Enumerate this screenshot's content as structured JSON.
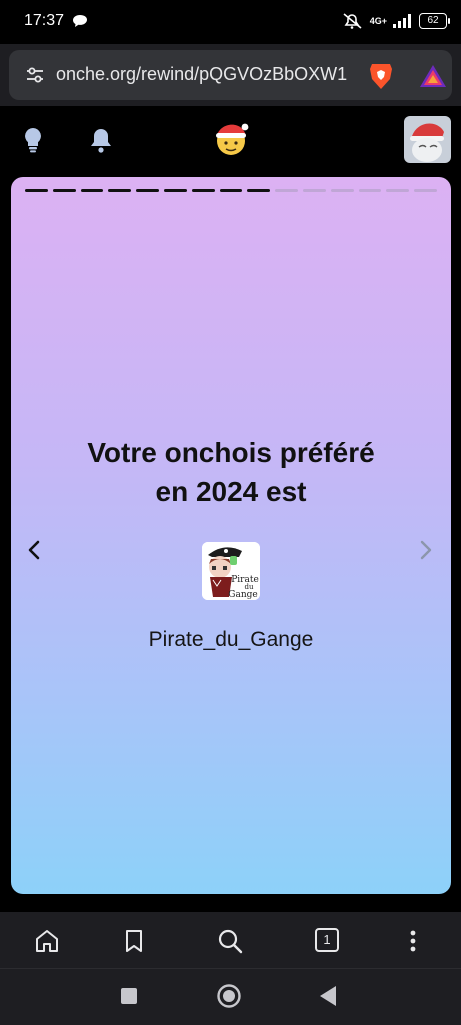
{
  "status_bar": {
    "time": "17:37",
    "network": "4G+",
    "battery": "62"
  },
  "browser": {
    "url": "onche.org/rewind/pQGVOzBbOXW1"
  },
  "site_header": {
    "icons": [
      "lightbulb-icon",
      "bell-icon",
      "santa-mascot-logo",
      "user-avatar"
    ]
  },
  "story": {
    "total_segments": 15,
    "completed_segments": 9,
    "title_line1": "Votre onchois préféré",
    "title_line2": "en 2024 est",
    "username": "Pirate_du_Gange",
    "avatar_text_line1": "Pirate",
    "avatar_text_line2": "du",
    "avatar_text_line3": "Gange"
  },
  "toolbar": {
    "tab_count": "1"
  },
  "colors": {
    "gradient_top": "#dcb1f3",
    "gradient_bottom": "#8dd1f9",
    "chrome_bg": "#1e1e22",
    "brave_orange": "#fb542b"
  }
}
